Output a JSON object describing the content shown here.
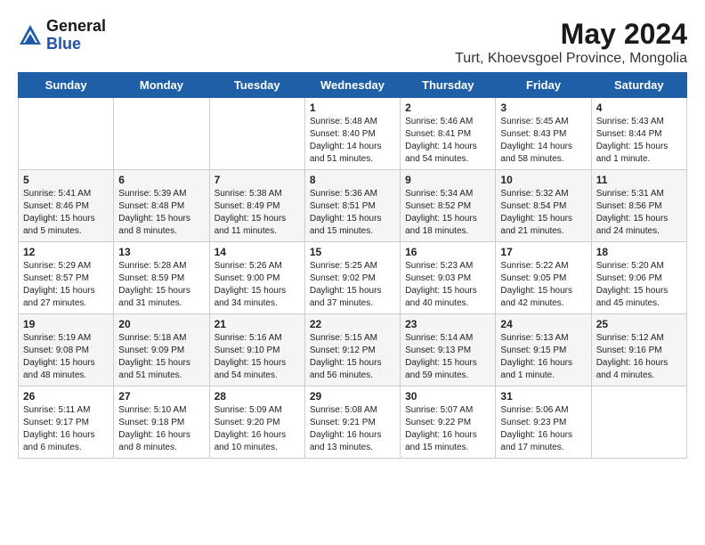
{
  "header": {
    "logo_general": "General",
    "logo_blue": "Blue",
    "month_year": "May 2024",
    "location": "Turt, Khoevsgoel Province, Mongolia"
  },
  "weekdays": [
    "Sunday",
    "Monday",
    "Tuesday",
    "Wednesday",
    "Thursday",
    "Friday",
    "Saturday"
  ],
  "weeks": [
    [
      {
        "day": "",
        "info": ""
      },
      {
        "day": "",
        "info": ""
      },
      {
        "day": "",
        "info": ""
      },
      {
        "day": "1",
        "info": "Sunrise: 5:48 AM\nSunset: 8:40 PM\nDaylight: 14 hours\nand 51 minutes."
      },
      {
        "day": "2",
        "info": "Sunrise: 5:46 AM\nSunset: 8:41 PM\nDaylight: 14 hours\nand 54 minutes."
      },
      {
        "day": "3",
        "info": "Sunrise: 5:45 AM\nSunset: 8:43 PM\nDaylight: 14 hours\nand 58 minutes."
      },
      {
        "day": "4",
        "info": "Sunrise: 5:43 AM\nSunset: 8:44 PM\nDaylight: 15 hours\nand 1 minute."
      }
    ],
    [
      {
        "day": "5",
        "info": "Sunrise: 5:41 AM\nSunset: 8:46 PM\nDaylight: 15 hours\nand 5 minutes."
      },
      {
        "day": "6",
        "info": "Sunrise: 5:39 AM\nSunset: 8:48 PM\nDaylight: 15 hours\nand 8 minutes."
      },
      {
        "day": "7",
        "info": "Sunrise: 5:38 AM\nSunset: 8:49 PM\nDaylight: 15 hours\nand 11 minutes."
      },
      {
        "day": "8",
        "info": "Sunrise: 5:36 AM\nSunset: 8:51 PM\nDaylight: 15 hours\nand 15 minutes."
      },
      {
        "day": "9",
        "info": "Sunrise: 5:34 AM\nSunset: 8:52 PM\nDaylight: 15 hours\nand 18 minutes."
      },
      {
        "day": "10",
        "info": "Sunrise: 5:32 AM\nSunset: 8:54 PM\nDaylight: 15 hours\nand 21 minutes."
      },
      {
        "day": "11",
        "info": "Sunrise: 5:31 AM\nSunset: 8:56 PM\nDaylight: 15 hours\nand 24 minutes."
      }
    ],
    [
      {
        "day": "12",
        "info": "Sunrise: 5:29 AM\nSunset: 8:57 PM\nDaylight: 15 hours\nand 27 minutes."
      },
      {
        "day": "13",
        "info": "Sunrise: 5:28 AM\nSunset: 8:59 PM\nDaylight: 15 hours\nand 31 minutes."
      },
      {
        "day": "14",
        "info": "Sunrise: 5:26 AM\nSunset: 9:00 PM\nDaylight: 15 hours\nand 34 minutes."
      },
      {
        "day": "15",
        "info": "Sunrise: 5:25 AM\nSunset: 9:02 PM\nDaylight: 15 hours\nand 37 minutes."
      },
      {
        "day": "16",
        "info": "Sunrise: 5:23 AM\nSunset: 9:03 PM\nDaylight: 15 hours\nand 40 minutes."
      },
      {
        "day": "17",
        "info": "Sunrise: 5:22 AM\nSunset: 9:05 PM\nDaylight: 15 hours\nand 42 minutes."
      },
      {
        "day": "18",
        "info": "Sunrise: 5:20 AM\nSunset: 9:06 PM\nDaylight: 15 hours\nand 45 minutes."
      }
    ],
    [
      {
        "day": "19",
        "info": "Sunrise: 5:19 AM\nSunset: 9:08 PM\nDaylight: 15 hours\nand 48 minutes."
      },
      {
        "day": "20",
        "info": "Sunrise: 5:18 AM\nSunset: 9:09 PM\nDaylight: 15 hours\nand 51 minutes."
      },
      {
        "day": "21",
        "info": "Sunrise: 5:16 AM\nSunset: 9:10 PM\nDaylight: 15 hours\nand 54 minutes."
      },
      {
        "day": "22",
        "info": "Sunrise: 5:15 AM\nSunset: 9:12 PM\nDaylight: 15 hours\nand 56 minutes."
      },
      {
        "day": "23",
        "info": "Sunrise: 5:14 AM\nSunset: 9:13 PM\nDaylight: 15 hours\nand 59 minutes."
      },
      {
        "day": "24",
        "info": "Sunrise: 5:13 AM\nSunset: 9:15 PM\nDaylight: 16 hours\nand 1 minute."
      },
      {
        "day": "25",
        "info": "Sunrise: 5:12 AM\nSunset: 9:16 PM\nDaylight: 16 hours\nand 4 minutes."
      }
    ],
    [
      {
        "day": "26",
        "info": "Sunrise: 5:11 AM\nSunset: 9:17 PM\nDaylight: 16 hours\nand 6 minutes."
      },
      {
        "day": "27",
        "info": "Sunrise: 5:10 AM\nSunset: 9:18 PM\nDaylight: 16 hours\nand 8 minutes."
      },
      {
        "day": "28",
        "info": "Sunrise: 5:09 AM\nSunset: 9:20 PM\nDaylight: 16 hours\nand 10 minutes."
      },
      {
        "day": "29",
        "info": "Sunrise: 5:08 AM\nSunset: 9:21 PM\nDaylight: 16 hours\nand 13 minutes."
      },
      {
        "day": "30",
        "info": "Sunrise: 5:07 AM\nSunset: 9:22 PM\nDaylight: 16 hours\nand 15 minutes."
      },
      {
        "day": "31",
        "info": "Sunrise: 5:06 AM\nSunset: 9:23 PM\nDaylight: 16 hours\nand 17 minutes."
      },
      {
        "day": "",
        "info": ""
      }
    ]
  ]
}
